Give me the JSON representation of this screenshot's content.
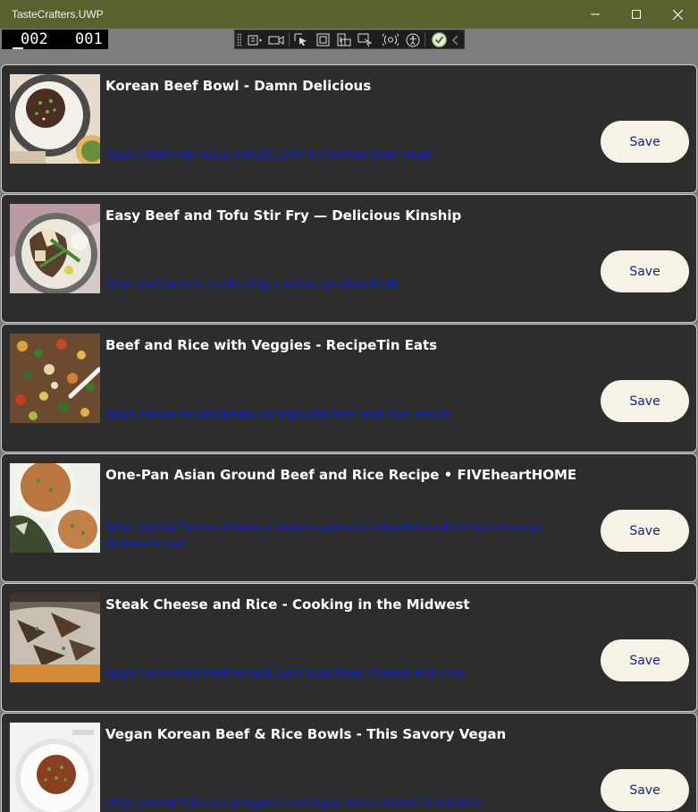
{
  "window": {
    "title": "TasteCrafters.UWP",
    "titlebar_color": "#58622e"
  },
  "frame_counter": {
    "left_value": "002",
    "right_value": "001"
  },
  "dev_toolbar": {
    "tools": [
      "add-frame-icon",
      "record-icon",
      "select-element-icon",
      "display-layout-icon",
      "track-focus-icon",
      "binding-failures-icon",
      "accessibility-icon",
      "checkmark-icon",
      "collapse-chevron-icon"
    ]
  },
  "theme": {
    "card_bg": "#2d2d2d",
    "link_color": "#0b1fd6",
    "button_bg": "#f7f2e6"
  },
  "recipes": [
    {
      "title": "Korean Beef Bowl - Damn Delicious",
      "url": "https://damndelicious.net/2013/07/07/korean-beef-bowl/",
      "save_label": "Save",
      "thumb": "korean-beef-bowl-image"
    },
    {
      "title": "Easy Beef and Tofu Stir Fry — Delicious Kinship",
      "url": "https://www.deliciouskinship.com/recipes/beef-tofu",
      "save_label": "Save",
      "thumb": "beef-tofu-stir-fry-image"
    },
    {
      "title": "Beef and Rice with Veggies - RecipeTin Eats",
      "url": "https://www.recipetineats.com/ground-beef-and-rice-recipe/",
      "save_label": "Save",
      "thumb": "beef-rice-veggies-image"
    },
    {
      "title": "One-Pan Asian Ground Beef and Rice Recipe • FIVEheartHOME",
      "url": "https://www.fivehearthome.com/one-pan-asian-beef-rice-skillet-quick-easy-dinner-recipe/",
      "save_label": "Save",
      "thumb": "asian-ground-beef-rice-image"
    },
    {
      "title": "Steak Cheese and Rice - Cooking in the Midwest",
      "url": "https://cookinginthemidwest.com/blog/steak-cheese-and-rice/",
      "save_label": "Save",
      "thumb": "steak-cheese-rice-image"
    },
    {
      "title": "Vegan Korean Beef & Rice Bowls - This Savory Vegan",
      "url": "https://www.thissavoryvegan.com/vegan-korean-beef-rice-bowls/",
      "save_label": "Save",
      "thumb": "vegan-korean-beef-bowl-image"
    }
  ]
}
